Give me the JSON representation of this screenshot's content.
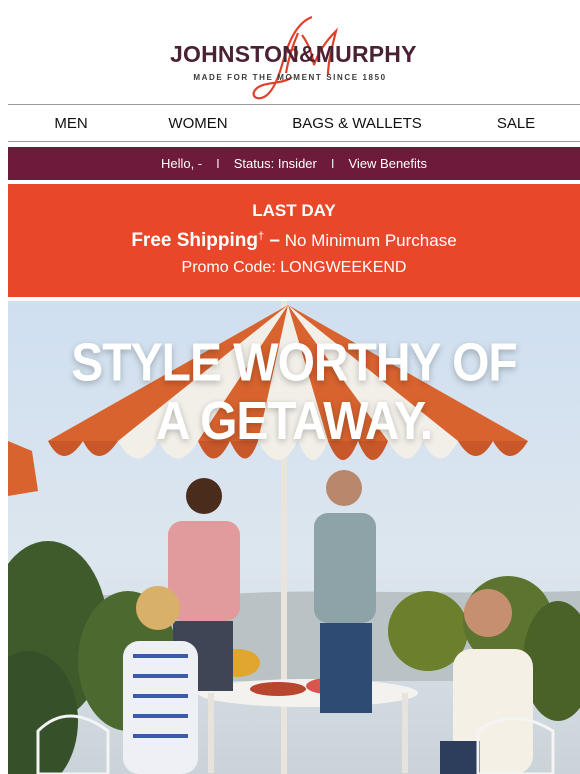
{
  "brand": {
    "name": "JOHNSTON&MURPHY",
    "tagline": "MADE FOR THE MOMENT SINCE 1850"
  },
  "nav": {
    "items": [
      "MEN",
      "WOMEN",
      "BAGS & WALLETS",
      "SALE"
    ]
  },
  "loyalty": {
    "greeting": "Hello, -",
    "separator": "I",
    "status": "Status: Insider",
    "benefits_link": "View Benefits"
  },
  "promo": {
    "headline": "LAST DAY",
    "shipping_bold": "Free Shipping",
    "shipping_mark": "†",
    "shipping_dash": " –",
    "shipping_rest": "No Minimum Purchase",
    "code_line": "Promo Code: LONGWEEKEND"
  },
  "hero": {
    "title_line1": "STYLE WORTHY OF",
    "title_line2": "A GETAWAY."
  },
  "colors": {
    "brand_wine": "#6d1a3b",
    "promo_orange": "#e8472a",
    "logo_red": "#e0402b",
    "logo_text": "#4b2135"
  }
}
